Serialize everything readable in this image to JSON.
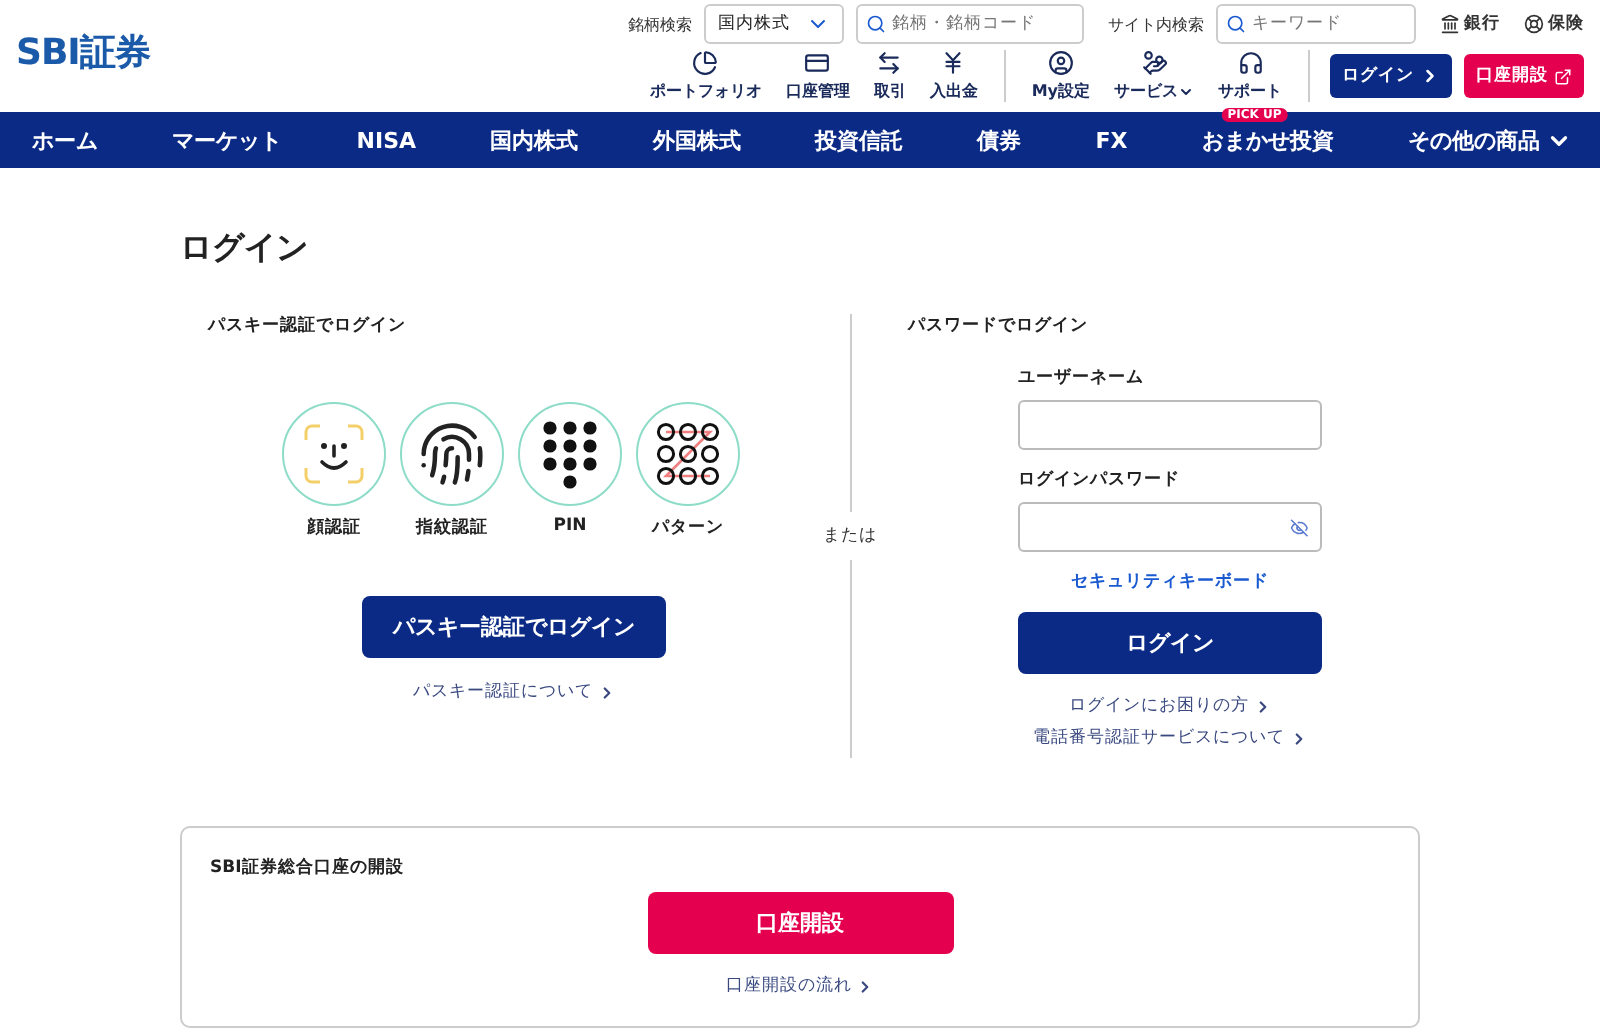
{
  "header": {
    "logo": "SBI証券",
    "stock_search": {
      "label": "銘柄検索",
      "market": "国内株式",
      "placeholder": "銘柄・銘柄コード"
    },
    "site_search": {
      "label": "サイト内検索",
      "placeholder": "キーワード"
    },
    "top_links": [
      "銀行",
      "保険"
    ],
    "tools": [
      [
        {
          "label": "ポートフォリオ",
          "menu": false
        },
        {
          "label": "口座管理",
          "menu": false
        },
        {
          "label": "取引",
          "menu": false
        },
        {
          "label": "入出金",
          "menu": false
        }
      ],
      [
        {
          "label": "My設定",
          "menu": false
        },
        {
          "label": "サービス",
          "menu": true
        },
        {
          "label": "サポート",
          "menu": false
        }
      ]
    ],
    "login_button": "ログイン",
    "open_account_button": "口座開設"
  },
  "nav": [
    {
      "label": "ホーム",
      "menu": false
    },
    {
      "label": "マーケット",
      "menu": false
    },
    {
      "label": "NISA",
      "menu": false
    },
    {
      "label": "国内株式",
      "menu": false
    },
    {
      "label": "外国株式",
      "menu": false
    },
    {
      "label": "投資信託",
      "menu": false
    },
    {
      "label": "債券",
      "menu": false
    },
    {
      "label": "FX",
      "menu": false
    },
    {
      "label": "おまかせ投資",
      "menu": false,
      "badge": "PICK UP"
    },
    {
      "label": "その他の商品",
      "menu": true
    }
  ],
  "title": "ログイン",
  "passkey": {
    "heading": "パスキー認証でログイン",
    "methods": [
      {
        "kind": "face",
        "label": "顔認証"
      },
      {
        "kind": "fingerprint",
        "label": "指紋認証"
      },
      {
        "kind": "pin",
        "label": "PIN"
      },
      {
        "kind": "pattern",
        "label": "パターン"
      }
    ],
    "button": "パスキー認証でログイン",
    "link": "パスキー認証について"
  },
  "separator": "または",
  "password": {
    "heading": "パスワードでログイン",
    "username_label": "ユーザーネーム",
    "password_label": "ログインパスワード",
    "keyboard_link": "セキュリティキーボード",
    "button": "ログイン",
    "links": [
      "ログインにお困りの方",
      "電話番号認証サービスについて"
    ]
  },
  "account": {
    "heading": "SBI証券総合口座の開設",
    "button": "口座開設",
    "link": "口座開設の流れ"
  }
}
